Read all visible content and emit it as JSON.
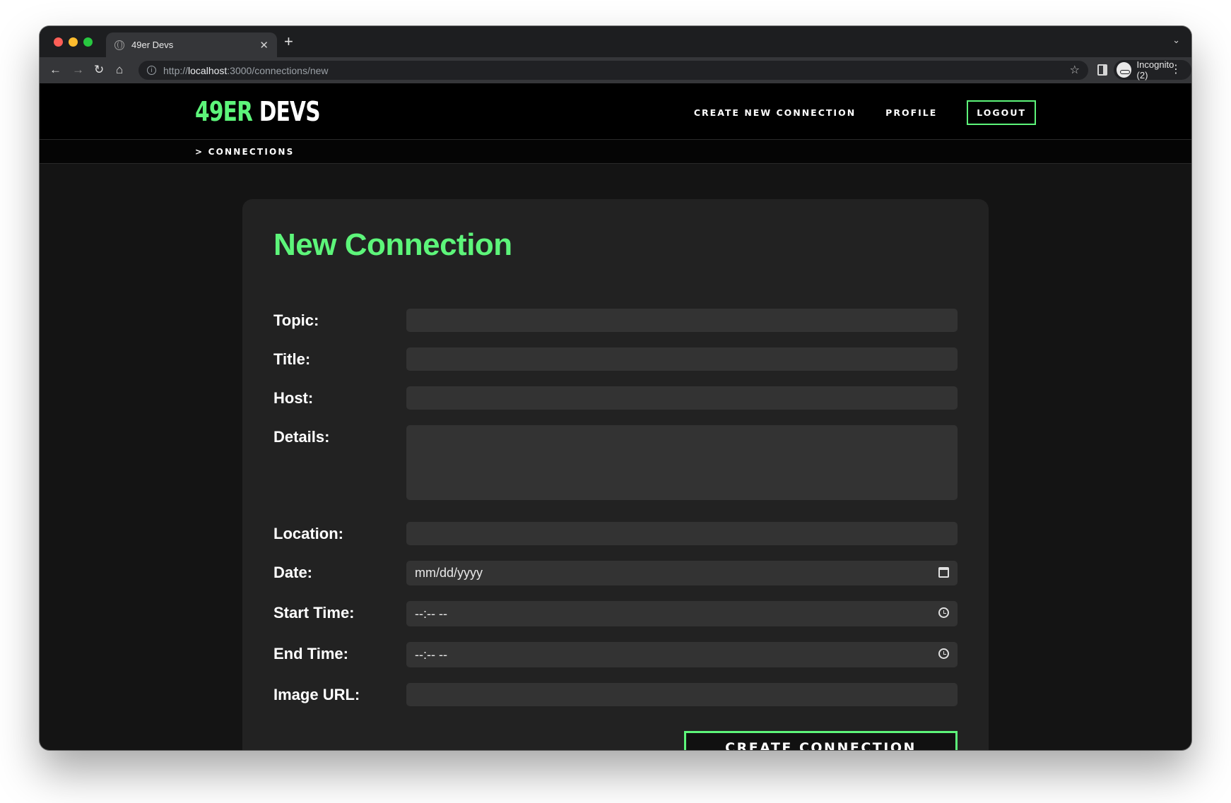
{
  "browser": {
    "tab_title": "49er Devs",
    "tab_close": "✕",
    "new_tab": "+",
    "url_scheme": "http://",
    "url_host": "localhost",
    "url_rest": ":3000/connections/new",
    "profile_label": "Incognito (2)"
  },
  "site": {
    "logo_number": "49ER",
    "logo_word": " DEVS",
    "nav": {
      "create": "CREATE NEW CONNECTION",
      "profile": "PROFILE",
      "logout": "LOGOUT"
    },
    "breadcrumb": "> CONNECTIONS"
  },
  "form": {
    "title": "New Connection",
    "topic_label": "Topic:",
    "title_label": "Title:",
    "host_label": "Host:",
    "details_label": "Details:",
    "location_label": "Location:",
    "date_label": "Date:",
    "date_placeholder": "mm/dd/yyyy",
    "start_label": "Start Time:",
    "start_placeholder": "--:-- --",
    "end_label": "End Time:",
    "end_placeholder": "--:-- --",
    "image_label": "Image URL:",
    "submit_label": "CREATE CONNECTION"
  },
  "colors": {
    "accent": "#5df57a",
    "card": "#222222",
    "field": "#333333"
  }
}
